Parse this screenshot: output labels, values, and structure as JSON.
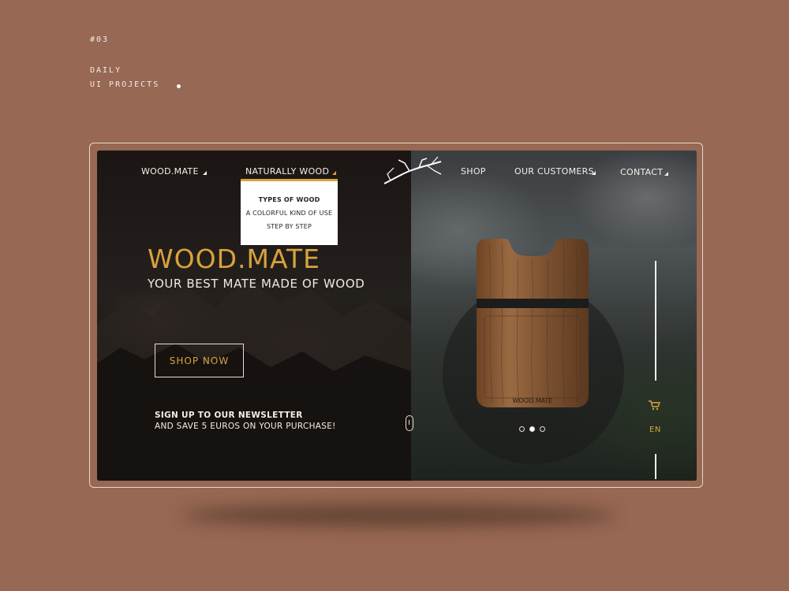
{
  "meta": {
    "number": "#03",
    "line1": "DAILY",
    "line2": "UI PROJECTS"
  },
  "nav": {
    "items": [
      {
        "label": "WOOD.MATE"
      },
      {
        "label": "NATURALLY WOOD"
      },
      {
        "label": "SHOP"
      },
      {
        "label": "OUR CUSTOMERS"
      },
      {
        "label": "CONTACT"
      }
    ],
    "dropdown": [
      "TYPES OF WOOD",
      "A COLORFUL KIND OF USE",
      "STEP BY STEP"
    ]
  },
  "hero": {
    "title": "WOOD.MATE",
    "subtitle": "YOUR BEST MATE MADE OF WOOD",
    "cta": "SHOP NOW"
  },
  "newsletter": {
    "heading": "SIGN UP TO  OUR NEWSLETTER",
    "text": "AND SAVE 5 EUROS ON YOUR PURCHASE!"
  },
  "product": {
    "brand": "WOOD.MATE",
    "slides": 3,
    "active_slide": 2
  },
  "rail": {
    "language": "EN"
  },
  "colors": {
    "background": "#976853",
    "accent": "#d9a23c",
    "text_light": "#f5eee8"
  },
  "icons": [
    "cart-icon",
    "logo-branch-icon",
    "scroll-mouse-icon"
  ]
}
